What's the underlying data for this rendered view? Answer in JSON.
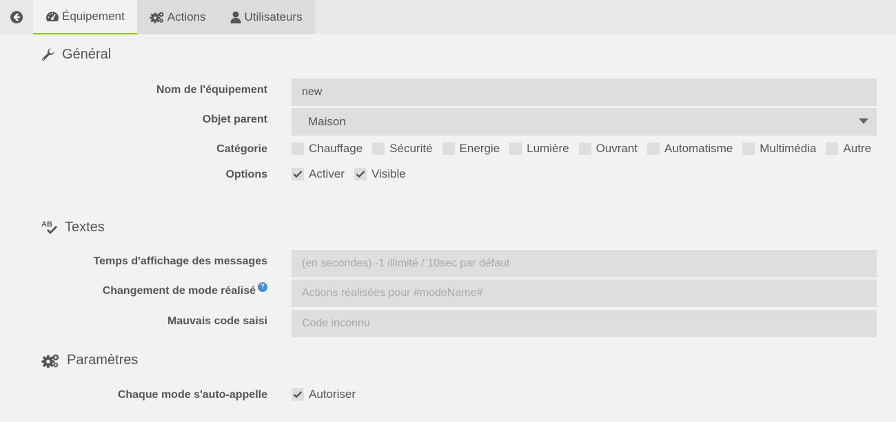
{
  "tabs": [
    {
      "label": "Équipement",
      "icon": "dashboard-icon",
      "active": true
    },
    {
      "label": "Actions",
      "icon": "gears-icon",
      "active": false
    },
    {
      "label": "Utilisateurs",
      "icon": "user-icon",
      "active": false
    }
  ],
  "general": {
    "title": "Général",
    "name_label": "Nom de l'équipement",
    "name_value": "new",
    "parent_label": "Objet parent",
    "parent_value": "Maison",
    "category_label": "Catégorie",
    "categories": [
      "Chauffage",
      "Sécurité",
      "Energie",
      "Lumière",
      "Ouvrant",
      "Automatisme",
      "Multimédia",
      "Autre"
    ],
    "options_label": "Options",
    "options": [
      {
        "label": "Activer",
        "checked": true
      },
      {
        "label": "Visible",
        "checked": true
      }
    ]
  },
  "texts": {
    "title": "Textes",
    "display_time_label": "Temps d'affichage des messages",
    "display_time_placeholder": "(en secondes) -1 illimité / 10sec par défaut",
    "mode_change_label": "Changement de mode réalisé",
    "mode_change_placeholder": "Actions réalisées pour #modeName#",
    "bad_code_label": "Mauvais code saisi",
    "bad_code_placeholder": "Code inconnu"
  },
  "params": {
    "title": "Paramètres",
    "auto_call_label": "Chaque mode s'auto-appelle",
    "auto_call_option": "Autoriser",
    "auto_call_checked": true
  },
  "colors": {
    "accent": "#94ca02",
    "help": "#3b8fd8"
  }
}
